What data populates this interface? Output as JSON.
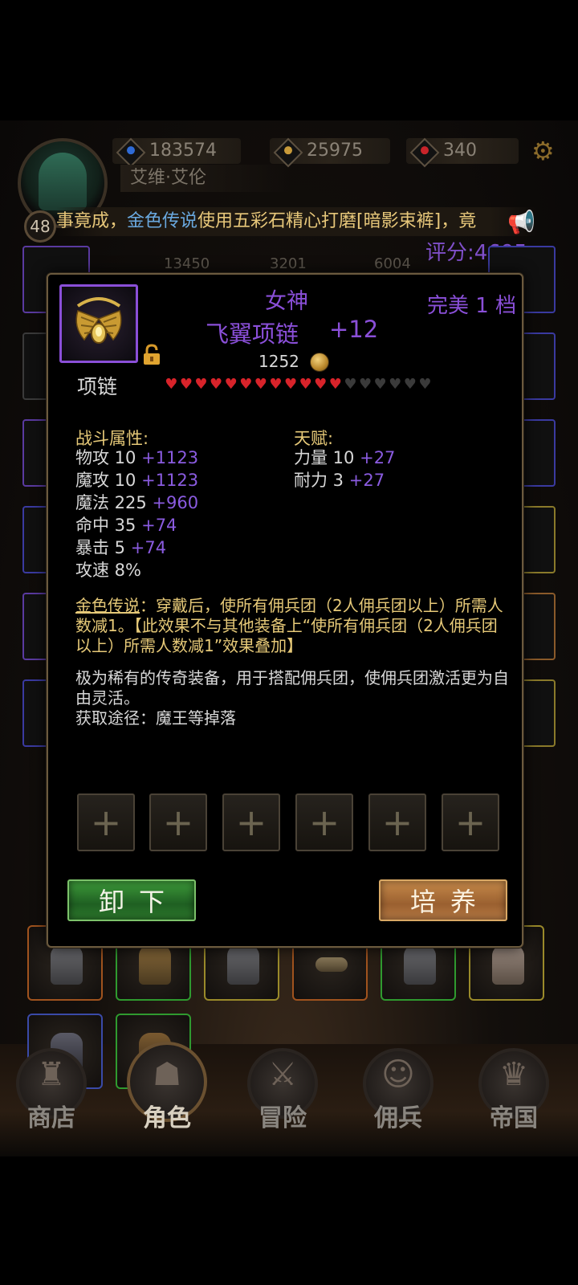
{
  "player": {
    "level": "48",
    "name": "艾维·艾伦"
  },
  "resources": [
    {
      "name": "crystal",
      "value": "183574",
      "color": "#2f6bd6"
    },
    {
      "name": "gold",
      "value": "25975",
      "color": "#c79a3a"
    },
    {
      "name": "ruby",
      "value": "340",
      "color": "#c8242a"
    }
  ],
  "ticker": {
    "part1": "事竟成，",
    "part2": "金色传说",
    "part3": "使用五彩石精心打磨[暗影束裤]，竟"
  },
  "score": "评分:4695",
  "bg_stats": [
    "13450",
    "3201",
    "6004"
  ],
  "modal": {
    "item_type": "项链",
    "quality": "女神",
    "name": "飞翼项链",
    "enhance": "+12",
    "perfect": "完美 1 档",
    "price": "1252",
    "hearts_filled": 12,
    "hearts_total": 18,
    "combat_title": "战斗属性:",
    "combat_stats": [
      {
        "label": "物攻 10",
        "bonus": "+1123"
      },
      {
        "label": "魔攻 10",
        "bonus": "+1123"
      },
      {
        "label": "魔法 225",
        "bonus": "+960"
      },
      {
        "label": "命中 35",
        "bonus": "+74"
      },
      {
        "label": "暴击 5",
        "bonus": "+74"
      },
      {
        "label": "攻速 8%",
        "bonus": ""
      }
    ],
    "talent_title": "天赋:",
    "talent_stats": [
      {
        "label": "力量 10",
        "bonus": "+27"
      },
      {
        "label": "耐力 3",
        "bonus": "+27"
      }
    ],
    "legend_title": "金色传说",
    "legend_text": "：穿戴后，使所有佣兵团（2人佣兵团以上）所需人数减1。【此效果不与其他装备上“使所有佣兵团（2人佣兵团以上）所需人数减1”效果叠加】",
    "desc_line1": "极为稀有的传奇装备，用于搭配佣兵团，使佣兵团激活更为自由灵活。",
    "desc_line2": "获取途径：魔王等掉落",
    "socket_symbol": "+",
    "unequip_label": "卸下",
    "train_label": "培养"
  },
  "nav": [
    {
      "label": "商店",
      "icon": "shop-icon"
    },
    {
      "label": "角色",
      "icon": "character-icon"
    },
    {
      "label": "冒险",
      "icon": "adventure-icon"
    },
    {
      "label": "佣兵",
      "icon": "mercenary-icon"
    },
    {
      "label": "帝国",
      "icon": "empire-icon"
    }
  ],
  "colors": {
    "epic_purple": "#8a4fd8",
    "gold_text": "#e6c978",
    "heart_red": "#d8232a",
    "heart_empty": "#3a3a3a"
  }
}
